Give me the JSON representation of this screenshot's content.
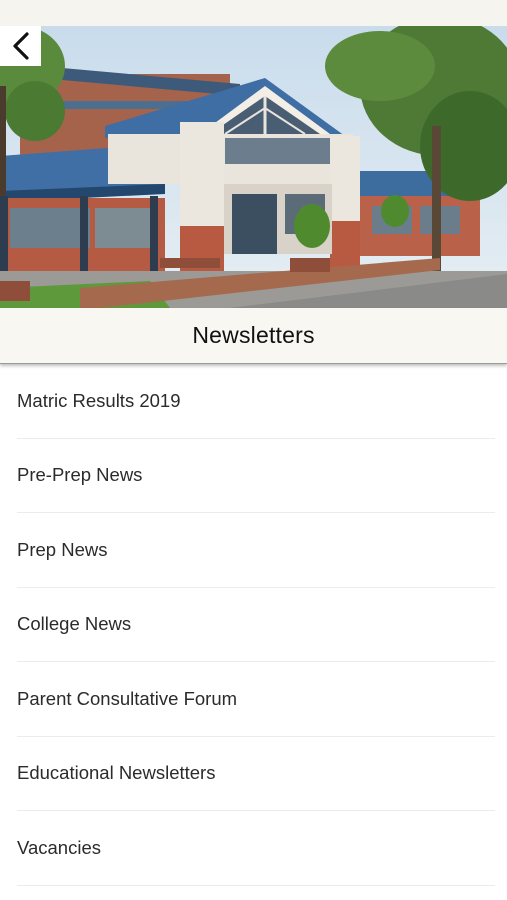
{
  "header": {
    "title": "Newsletters",
    "back_icon": "chevron-left-icon"
  },
  "hero": {
    "image": "school-building-photo"
  },
  "newsletters": [
    {
      "label": "Matric Results 2019"
    },
    {
      "label": "Pre-Prep News"
    },
    {
      "label": "Prep News"
    },
    {
      "label": "College News"
    },
    {
      "label": "Parent Consultative Forum"
    },
    {
      "label": "Educational Newsletters"
    },
    {
      "label": "Vacancies"
    }
  ],
  "colors": {
    "title_bar_bg": "#f8f7f1",
    "divider": "#ececec",
    "text": "#2b2b2b"
  }
}
